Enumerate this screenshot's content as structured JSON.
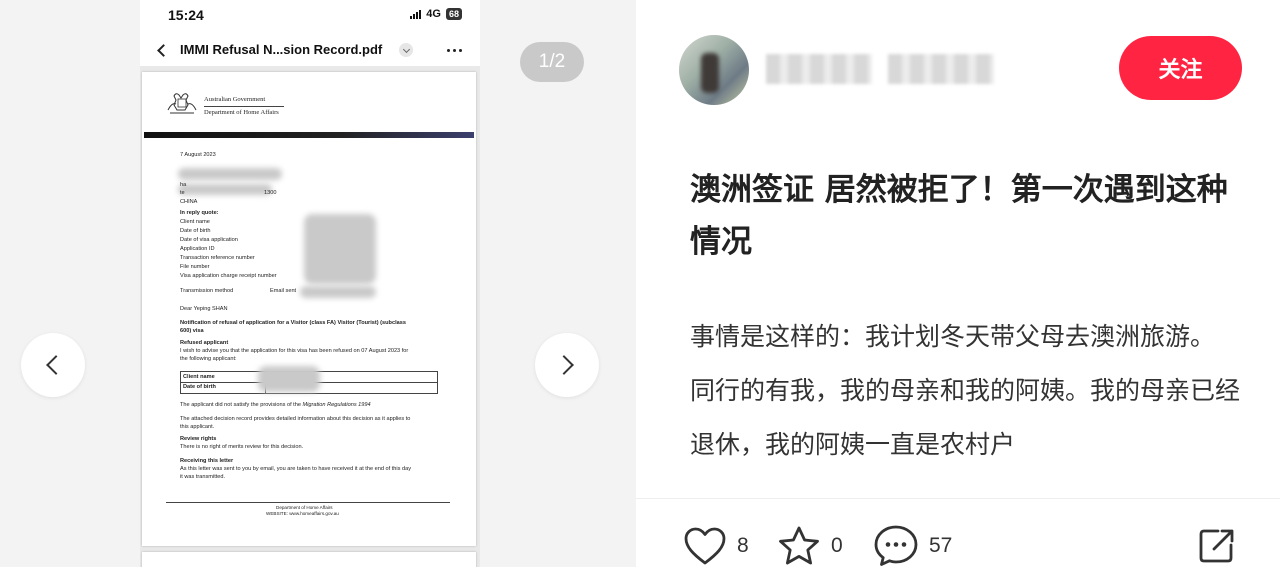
{
  "phone": {
    "status_time": "15:24",
    "network": "4G",
    "battery": "68",
    "pdf_title": "IMMI Refusal N...sion Record.pdf"
  },
  "letter": {
    "gov_line1": "Australian Government",
    "gov_line2": "Department of Home Affairs",
    "date": "7 August 2023",
    "reply_quote": "In reply quote:",
    "fields": [
      "Client name",
      "Date of birth",
      "Date of visa application",
      "Application ID",
      "Transaction reference number",
      "File number",
      "Visa application charge receipt number"
    ],
    "transmission_method": "Transmission method",
    "email_sent": "Email sent",
    "greeting": "Dear Yeping SHAN",
    "notification_1": "Notification of refusal of application for a Visitor (class FA) Visitor (Tourist) (subclass",
    "notification_2": "600) visa",
    "refused_applicant": "Refused applicant",
    "advise_1": "I wish to advise you that the application for this visa has been refused on 07 August 2023 for",
    "advise_2": "the following applicant:",
    "table_client_name": "Client name",
    "table_dob": "Date of birth",
    "not_satisfy_prefix": "The applicant did not satisfy the provisions of the ",
    "not_satisfy_regs": "Migration Regulations 1994",
    "attached_1": "The attached decision record provides detailed information about this decision as it applies to",
    "attached_2": "this applicant.",
    "review_rights": "Review rights",
    "no_review": "There is no right of merits review for this decision.",
    "receiving": "Receiving this letter",
    "receiving_1": "As this letter was sent to you by email, you are taken to have received it at the end of this day",
    "receiving_2": "it was transmitted.",
    "footer_1": "Department of Home Affairs",
    "footer_2": "WEBSITE: www.homeaffairs.gov.au",
    "address_fragments": [
      "CHINA",
      "te",
      "ha",
      "1300"
    ]
  },
  "gallery": {
    "page_counter": "1/2"
  },
  "author": {
    "follow_label": "关注"
  },
  "post": {
    "title": "澳洲签证 居然被拒了！第一次遇到这种情况",
    "body": [
      "事情是这样的：我计划冬天带父母去澳洲旅游。",
      "同行的有我，我的母亲和我的阿姨。我的母亲已经退休，我的阿姨一直是农村户"
    ]
  },
  "actions": {
    "like_count": "8",
    "collect_count": "0",
    "comment_count": "57"
  },
  "colors": {
    "accent": "#ff2442",
    "counter_bg": "#c9c9c9"
  }
}
